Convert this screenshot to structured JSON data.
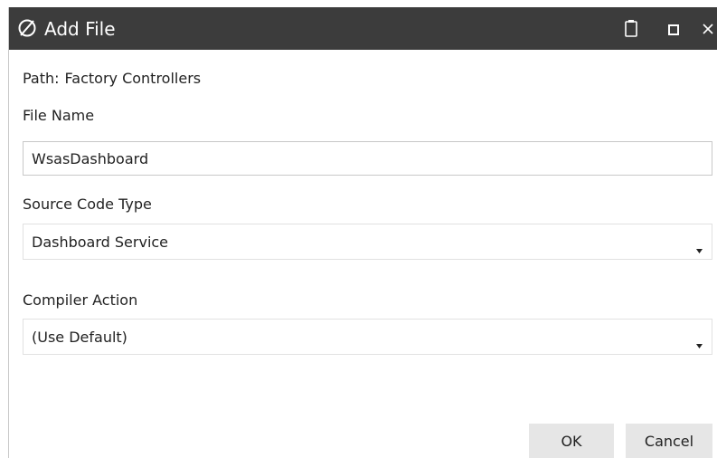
{
  "dialog": {
    "title": "Add File",
    "logo_icon": "slashed-circle-logo-icon",
    "controls": {
      "clipboard_icon": "clipboard-icon",
      "maximize_icon": "maximize-icon",
      "close_icon": "close-icon"
    }
  },
  "path": {
    "label": "Path:",
    "value": "Factory Controllers"
  },
  "file_name": {
    "label": "File Name",
    "value": "WsasDashboard"
  },
  "source_code_type": {
    "label": "Source Code Type",
    "selected": "Dashboard Service",
    "arrow_icon": "dropdown-arrow-icon"
  },
  "compiler_action": {
    "label": "Compiler Action",
    "selected": "(Use Default)",
    "arrow_icon": "dropdown-arrow-icon"
  },
  "buttons": {
    "ok": "OK",
    "cancel": "Cancel"
  },
  "colors": {
    "titlebar": "#3c3c3c",
    "title_text": "#ffffff",
    "button_bg": "#e6e6e6",
    "input_border": "#c8c8c8"
  }
}
